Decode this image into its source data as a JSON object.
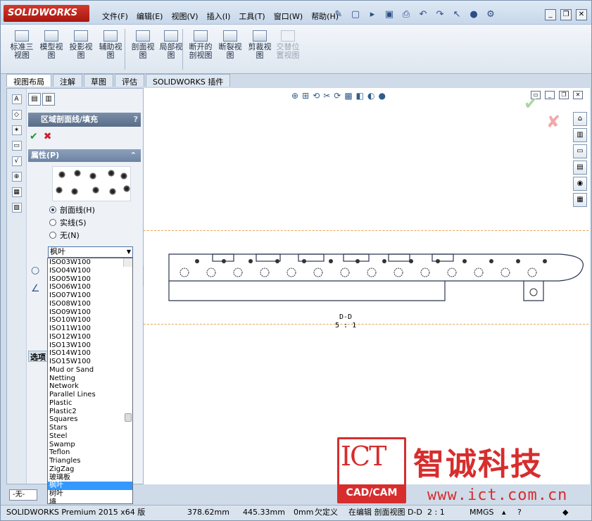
{
  "app": {
    "logo_text": "SOLIDWORKS",
    "menu": [
      "文件(F)",
      "编辑(E)",
      "视图(V)",
      "插入(I)",
      "工具(T)",
      "窗口(W)",
      "帮助(H)"
    ]
  },
  "command_manager": {
    "buttons": [
      {
        "label": "标准三\n视图",
        "enabled": true
      },
      {
        "label": "模型视\n图",
        "enabled": true
      },
      {
        "label": "投影视\n图",
        "enabled": true
      },
      {
        "label": "辅助视\n图",
        "enabled": true
      },
      {
        "label": "剖面视\n图",
        "enabled": true
      },
      {
        "label": "局部视\n图",
        "enabled": true
      },
      {
        "label": "断开的\n剖视图",
        "enabled": true
      },
      {
        "label": "断裂视\n图",
        "enabled": true
      },
      {
        "label": "剪裁视\n图",
        "enabled": true
      },
      {
        "label": "交替位\n置视图",
        "enabled": false
      }
    ],
    "tabs": [
      "视图布局",
      "注解",
      "草图",
      "评估",
      "SOLIDWORKS 插件"
    ]
  },
  "property_manager": {
    "title": "区域剖面线/填充",
    "help": "?",
    "properties_header": "属性(P)",
    "radio_hatch": "剖面线(H)",
    "radio_solid": "实线(S)",
    "radio_none": "无(N)",
    "selected_pattern": "枫叶",
    "options_header": "选项",
    "none_box": "-无-"
  },
  "pattern_list": {
    "items": [
      "ISO03W100",
      "ISO04W100",
      "ISO05W100",
      "ISO06W100",
      "ISO07W100",
      "ISO08W100",
      "ISO09W100",
      "ISO10W100",
      "ISO11W100",
      "ISO12W100",
      "ISO13W100",
      "ISO14W100",
      "ISO15W100",
      "Mud or Sand",
      "Netting",
      "Network",
      "Parallel Lines",
      "Plastic",
      "Plastic2",
      "Squares",
      "Stars",
      "Steel",
      "Swamp",
      "Teflon",
      "Triangles",
      "ZigZag",
      "玻璃板",
      "枫叶",
      "树叶",
      "墙"
    ],
    "selected": "枫叶"
  },
  "drawing": {
    "view_label": "D-D",
    "scale_label": "5 : 1"
  },
  "statusbar": {
    "product": "SOLIDWORKS Premium 2015 x64 版",
    "x": "378.62mm",
    "y": "445.33mm",
    "z": "0mm",
    "state": "欠定义",
    "editing": "在编辑 剖面视图 D-D",
    "ratio": "2 : 1",
    "units": "MMGS"
  },
  "watermark": {
    "logo": "ICT",
    "sub": "CAD/CAM",
    "company": "智诚科技",
    "url": "www.ict.com.cn"
  }
}
